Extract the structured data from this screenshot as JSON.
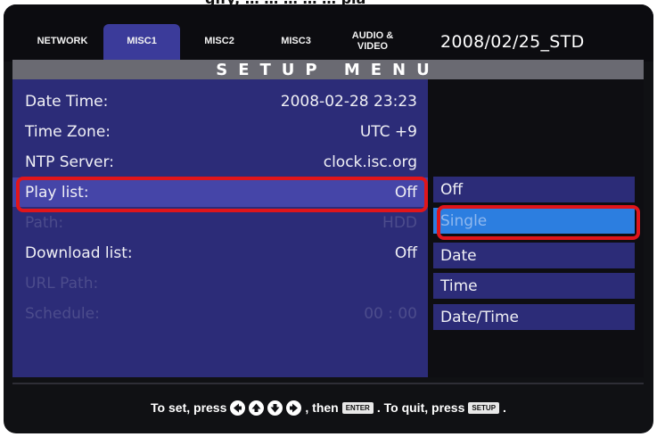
{
  "top_partial_text": "gify, … … … … … pla",
  "tabs": [
    {
      "label": "NETWORK"
    },
    {
      "label": "MISC1"
    },
    {
      "label": "MISC2"
    },
    {
      "label": "MISC3"
    },
    {
      "label": "AUDIO &\nVIDEO"
    }
  ],
  "active_tab": "MISC1",
  "firmware": "2008/02/25_STD",
  "title": "SETUP MENU",
  "settings": [
    {
      "label": "Date Time:",
      "value": "2008-02-28 23:23",
      "enabled": true
    },
    {
      "label": "Time Zone:",
      "value": "UTC +9",
      "enabled": true
    },
    {
      "label": "NTP Server:",
      "value": "clock.isc.org",
      "enabled": true
    },
    {
      "label": "Play list:",
      "value": "Off",
      "enabled": true,
      "focused": true
    },
    {
      "label": "Path:",
      "value": "HDD",
      "enabled": false
    },
    {
      "label": "Download list:",
      "value": "Off",
      "enabled": true
    },
    {
      "label": "URL Path:",
      "value": "",
      "enabled": false
    },
    {
      "label": "Schedule:",
      "value": "00 : 00",
      "enabled": false
    }
  ],
  "options": [
    {
      "label": "Off"
    },
    {
      "label": "Single"
    },
    {
      "label": "Date"
    },
    {
      "label": "Time"
    },
    {
      "label": "Date/Time"
    }
  ],
  "selected_option": "Single",
  "help": {
    "part1": "To set, press",
    "part2": ", then",
    "enter_key": "ENTER",
    "part3": ". To quit, press",
    "setup_key": "SETUP",
    "part4": "."
  },
  "colors": {
    "panel": "#2c2c78",
    "highlight_row": "#4545a8",
    "selected_option": "#2c7ee0",
    "annotation_red": "#e0151b",
    "title_bar": "#6a6a72"
  }
}
